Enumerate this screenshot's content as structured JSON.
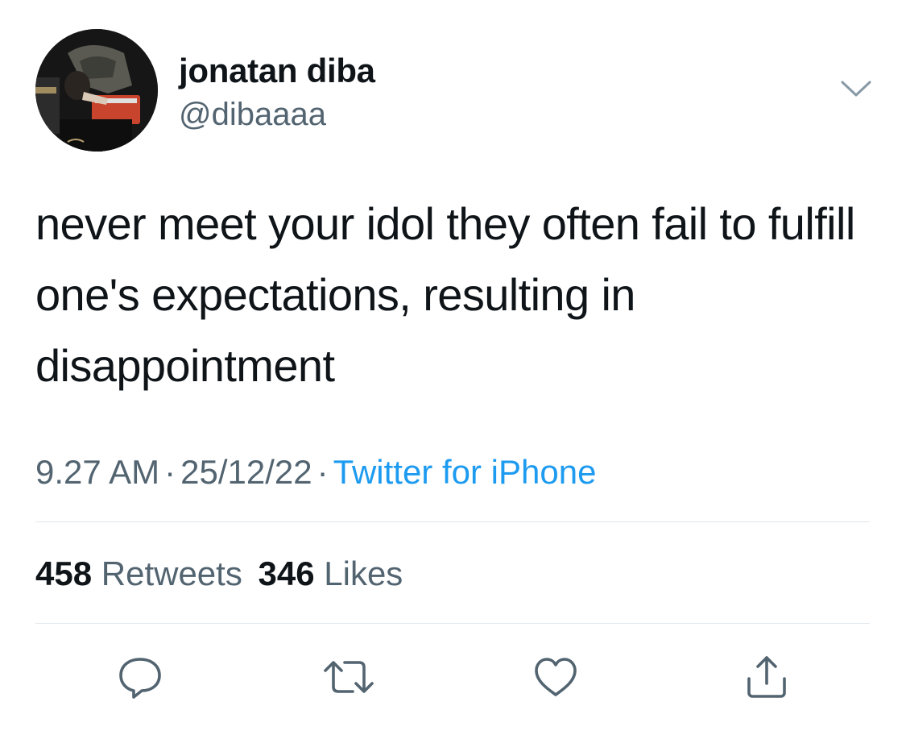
{
  "user": {
    "display_name": "jonatan diba",
    "handle": "@dibaaaa",
    "avatar_icon": "avatar-photo"
  },
  "tweet": {
    "text": "never meet your idol they often fail to fulfill one's expectations, resulting in disappointment",
    "time": "9.27 AM",
    "date": "25/12/22",
    "separator": "·",
    "source": "Twitter for iPhone"
  },
  "stats": {
    "retweets_count": "458",
    "retweets_label": "Retweets",
    "likes_count": "346",
    "likes_label": "Likes"
  },
  "actions": {
    "reply_icon": "reply-icon",
    "retweet_icon": "retweet-icon",
    "like_icon": "heart-icon",
    "share_icon": "share-icon"
  },
  "colors": {
    "text": "#0f1419",
    "secondary": "#536471",
    "link": "#1d9bf0",
    "divider": "#e1e8ed"
  }
}
